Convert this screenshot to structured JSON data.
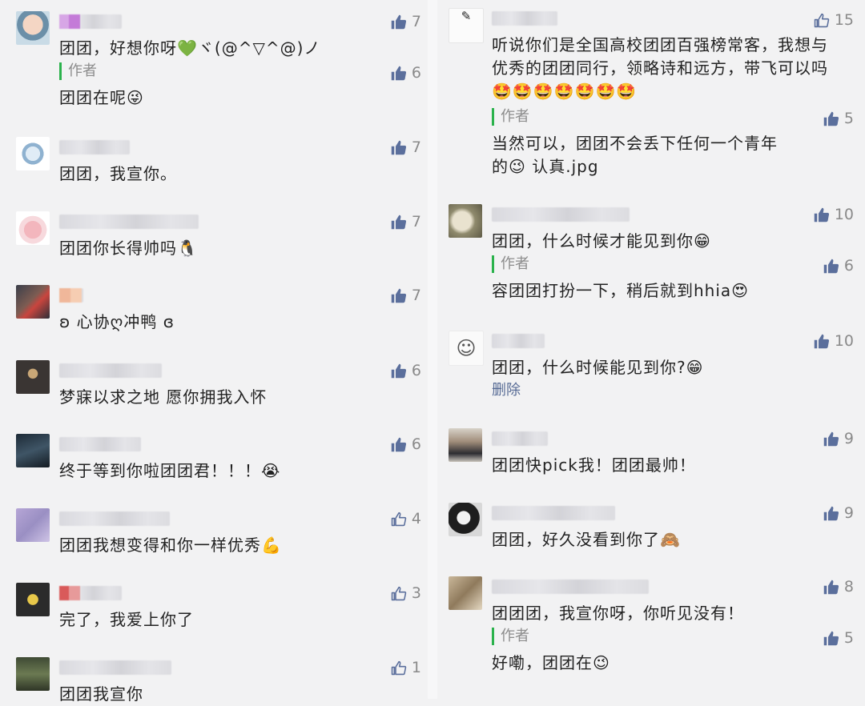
{
  "left_column": [
    {
      "text": "团团，好想你呀💚ヾ(@^▽^@)ノ",
      "likes": "7",
      "like_filled": true,
      "reply": {
        "tag": "作者",
        "text": "团团在呢😜",
        "likes": "6"
      }
    },
    {
      "text": "团团，我宣你。",
      "likes": "7",
      "like_filled": true
    },
    {
      "text": "团团你长得帅吗🐧",
      "likes": "7",
      "like_filled": true
    },
    {
      "text": "ʚ 心协ღ冲鸭 ɞ",
      "likes": "7",
      "like_filled": true
    },
    {
      "text": "梦寐以求之地 愿你拥我入怀",
      "likes": "6",
      "like_filled": true
    },
    {
      "text": "终于等到你啦团团君！！！😭",
      "likes": "6",
      "like_filled": true
    },
    {
      "text": "团团我想变得和你一样优秀💪",
      "likes": "4",
      "like_filled": false
    },
    {
      "text": "完了，我爱上你了",
      "likes": "3",
      "like_filled": false
    },
    {
      "text": "团团我宣你",
      "likes": "1",
      "like_filled": false
    }
  ],
  "right_column": [
    {
      "text": "听说你们是全国高校团团百强榜常客，我想与优秀的团团同行，领略诗和远方，带飞可以吗🤩🤩🤩🤩🤩🤩🤩",
      "likes": "15",
      "like_filled": false,
      "reply": {
        "tag": "作者",
        "text": "当然可以，团团不会丢下任何一个青年的😉 认真.jpg",
        "likes": "5"
      }
    },
    {
      "text": "团团，什么时候才能见到你😁",
      "likes": "10",
      "like_filled": true,
      "reply": {
        "tag": "作者",
        "text": "容团团打扮一下，稍后就到hhia😍",
        "likes": "6"
      }
    },
    {
      "text": "团团，什么时候能见到你?😁",
      "likes": "10",
      "like_filled": true,
      "delete_label": "删除"
    },
    {
      "text": "团团快pick我！团团最帅！",
      "likes": "9",
      "like_filled": true
    },
    {
      "text": "团团，好久没看到你了🙈",
      "likes": "9",
      "like_filled": true
    },
    {
      "text": "团团团，我宣你呀，你听见没有！",
      "likes": "8",
      "like_filled": true,
      "reply": {
        "tag": "作者",
        "text": "好嘞，团团在😉",
        "likes": "5"
      }
    }
  ],
  "colors": {
    "like_filled": "#5b6f9c",
    "like_outline": "#5b6f9c",
    "author_bar": "#2bb24c",
    "link": "#576b95"
  }
}
